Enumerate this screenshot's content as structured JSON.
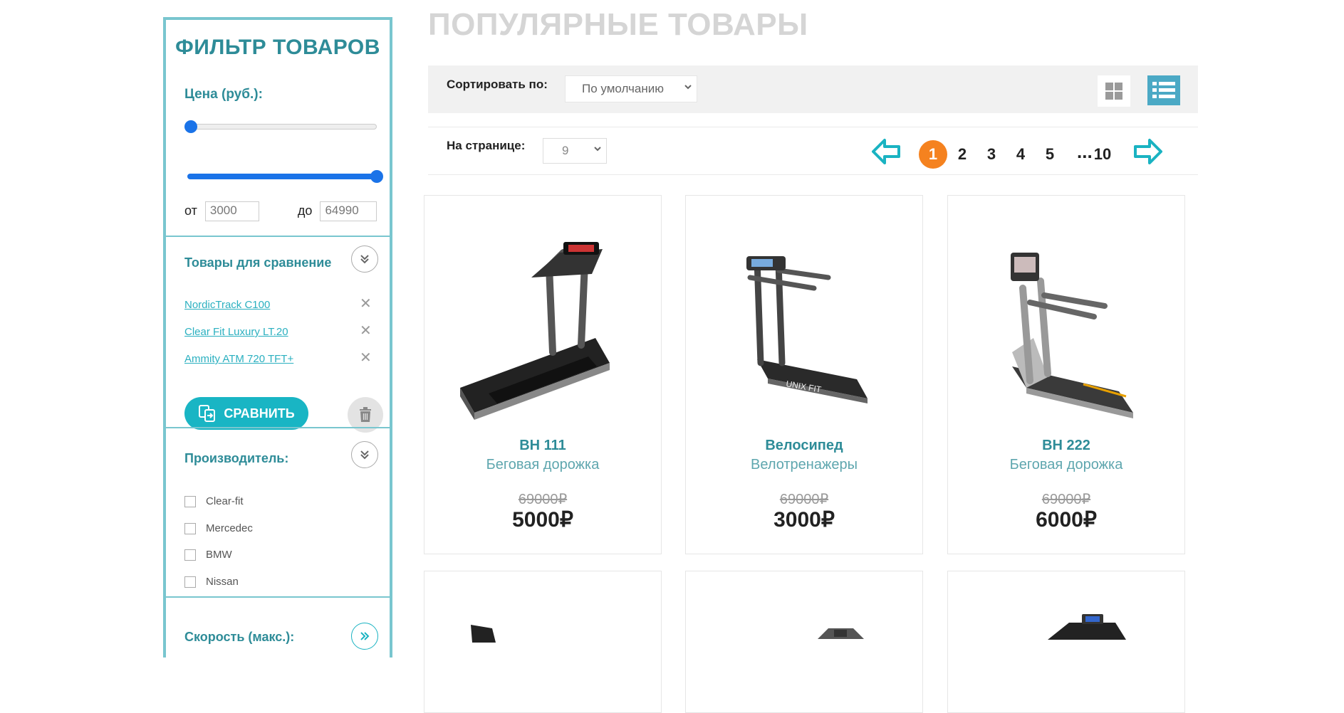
{
  "sidebar": {
    "title": "ФИЛЬТР ТОВАРОВ",
    "price_label": "Цена (руб.):",
    "price_from_label": "от",
    "price_from": "3000",
    "price_to_label": "до",
    "price_to": "64990",
    "compare_title": "Товары для сравнение",
    "compare_items": [
      "NordicTrack C100",
      "Clear Fit Luxury LT.20",
      "Ammity ATM 720 TFT+"
    ],
    "compare_button": "СРАВНИТЬ",
    "maker_title": "Производитель:",
    "makers": [
      "Clear-fit",
      "Mercedec",
      "BMW",
      "Nissan"
    ],
    "speed_title": "Скорость (макс.):"
  },
  "main": {
    "title": "ПОПУЛЯРНЫЕ ТОВАРЫ",
    "sort_label": "Сортировать по:",
    "sort_value": "По умолчанию",
    "per_page_label": "На странице:",
    "per_page_value": "9",
    "pages": [
      "1",
      "2",
      "3",
      "4",
      "5"
    ],
    "last_page": "10",
    "ellipsis": "..."
  },
  "products": [
    {
      "name": "BH 111",
      "category": "Беговая дорожка",
      "old_price": "69000₽",
      "price": "5000₽"
    },
    {
      "name": "Велосипед",
      "category": "Велотренажеры",
      "old_price": "69000₽",
      "price": "3000₽"
    },
    {
      "name": "BH 222",
      "category": "Беговая дорожка",
      "old_price": "69000₽",
      "price": "6000₽"
    }
  ],
  "colors": {
    "accent": "#2e8c98",
    "button": "#19b5c4",
    "active_page": "#f5821f",
    "slider": "#1a73e8"
  },
  "icons": [
    "chevrons-down-icon",
    "close-icon",
    "compare-icon",
    "trash-icon",
    "grid-view-icon",
    "list-view-icon",
    "arrow-left-icon",
    "arrow-right-icon",
    "chevrons-right-icon"
  ]
}
